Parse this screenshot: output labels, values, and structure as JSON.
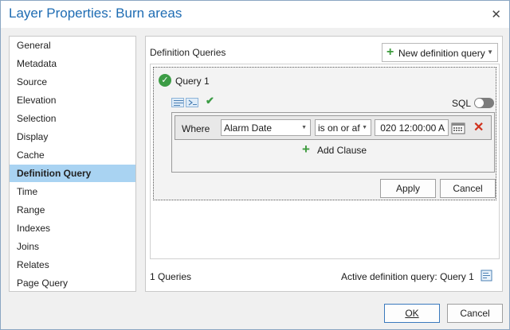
{
  "window": {
    "title": "Layer Properties: Burn areas",
    "close_glyph": "✕"
  },
  "sidebar": {
    "items": [
      {
        "label": "General"
      },
      {
        "label": "Metadata"
      },
      {
        "label": "Source"
      },
      {
        "label": "Elevation"
      },
      {
        "label": "Selection"
      },
      {
        "label": "Display"
      },
      {
        "label": "Cache"
      },
      {
        "label": "Definition Query",
        "selected": true
      },
      {
        "label": "Time"
      },
      {
        "label": "Range"
      },
      {
        "label": "Indexes"
      },
      {
        "label": "Joins"
      },
      {
        "label": "Relates"
      },
      {
        "label": "Page Query"
      }
    ]
  },
  "definition_queries": {
    "section_label": "Definition Queries",
    "new_query_button": "New definition query",
    "query": {
      "name": "Query 1",
      "sql_label": "SQL",
      "sql_enabled": false,
      "clause": {
        "where_label": "Where",
        "field": "Alarm Date",
        "operator": "is on or af",
        "value": "020 12:00:00 A"
      },
      "add_clause_label": "Add Clause",
      "apply_label": "Apply",
      "cancel_label": "Cancel"
    },
    "query_count_text": "1 Queries",
    "active_query_text": "Active definition query: Query 1"
  },
  "footer": {
    "ok_label": "OK",
    "cancel_label": "Cancel"
  },
  "colors": {
    "accent": "#1e6cb3",
    "selection": "#a9d3f2",
    "success": "#3c9c45",
    "danger": "#d0321d"
  },
  "icons": [
    "check-circle-icon",
    "clause-mode-icon",
    "sql-mode-icon",
    "verify-check-icon",
    "calendar-icon",
    "delete-icon",
    "plus-icon",
    "active-query-icon",
    "close-icon",
    "chevron-down-icon"
  ]
}
